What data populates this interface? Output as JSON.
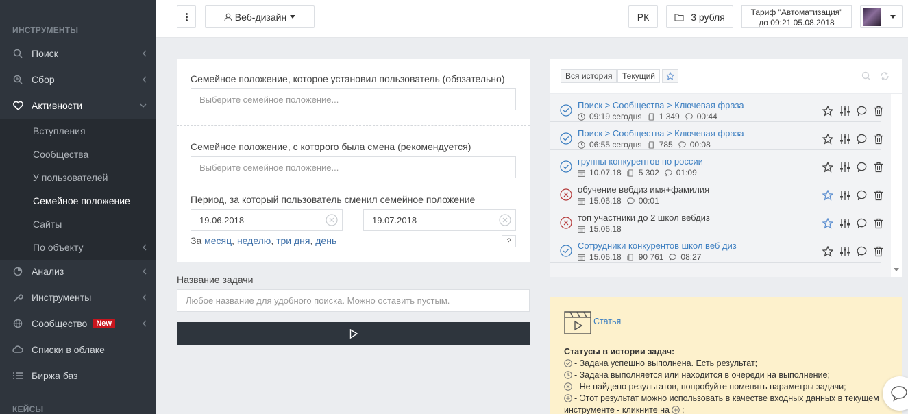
{
  "sidebar": {
    "section_tools": "ИНСТРУМЕНТЫ",
    "section_cases": "КЕЙСЫ",
    "items": [
      {
        "label": "Поиск",
        "icon": "search-icon"
      },
      {
        "label": "Сбор",
        "icon": "zoom-icon"
      },
      {
        "label": "Активности",
        "icon": "heart-icon"
      },
      {
        "label": "Анализ",
        "icon": "pie-icon"
      },
      {
        "label": "Инструменты",
        "icon": "wrench-icon"
      },
      {
        "label": "Сообщество",
        "icon": "globe-icon",
        "badge": "New"
      },
      {
        "label": "Списки в облаке",
        "icon": "cloud-icon"
      },
      {
        "label": "Биржа баз",
        "icon": "list-icon"
      }
    ],
    "sub_items": [
      "Вступления",
      "Сообщества",
      "У пользователей",
      "Семейное положение",
      "Сайты",
      "По объекту"
    ]
  },
  "topbar": {
    "project": "Веб-дизайн",
    "currency": "РК",
    "balance": "3 рубля",
    "tariff_line1": "Тариф \"Автоматизация\"",
    "tariff_line2": "до 09:21 05.08.2018"
  },
  "form": {
    "label_status": "Семейное положение, которое установил пользователь (обязательно)",
    "placeholder_status": "Выберите семейное положение...",
    "label_prev_status": "Семейное положение, с которого была смена (рекомендуется)",
    "placeholder_prev_status": "Выберите семейное положение...",
    "label_period": "Период, за который пользователь сменил семейное положение",
    "date_from": "19.06.2018",
    "date_to": "19.07.2018",
    "period_prefix": "За",
    "period_links": [
      "месяц",
      "неделю",
      "три дня",
      "день"
    ],
    "help": "?",
    "label_task_name": "Название задачи",
    "placeholder_task_name": "Любое название для удобного поиска. Можно оставить пустым."
  },
  "history": {
    "tab_all": "Вся история",
    "tab_current": "Текущий",
    "rows": [
      {
        "status": "success",
        "title": "Поиск > Сообщества > Ключевая фраза",
        "link": true,
        "time": "09:19 сегодня",
        "count": "1 349",
        "duration": "00:44"
      },
      {
        "status": "success",
        "title": "Поиск > Сообщества > Ключевая фраза",
        "link": true,
        "time": "06:55 сегодня",
        "count": "785",
        "duration": "00:08"
      },
      {
        "status": "success",
        "title": "группы конкурентов по россии",
        "link": true,
        "time": "10.07.18",
        "count": "5 302",
        "duration": "01:09"
      },
      {
        "status": "error",
        "title": "обучение вебдиз имя+фамилия",
        "link": false,
        "time": "15.06.18",
        "count": "",
        "duration": "00:01"
      },
      {
        "status": "error",
        "title": "топ участники до 2 школ вебдиз",
        "link": false,
        "time": "15.06.18",
        "count": "",
        "duration": ""
      },
      {
        "status": "success",
        "title": "Сотрудники конкурентов школ веб диз",
        "link": true,
        "time": "15.06.18",
        "count": "90 761",
        "duration": "08:27"
      }
    ]
  },
  "info": {
    "article": "Статья",
    "heading": "Статусы в истории задач:",
    "lines": [
      "- Задача успешно выполнена. Есть результат;",
      "- Задача выполняется или находится в очереди на выполнение;",
      "- Не найдено результатов, попробуйте поменять параметры задачи;",
      "- Этот результат можно использовать в качестве входных данных в текущем",
      "инструменте - кликните на",
      ";"
    ]
  },
  "colors": {
    "sidebar_bg": "#2f353d",
    "link": "#3d7fc1",
    "success": "#3d7fc1",
    "error": "#b53a3a",
    "info_bg": "#fdf1cc",
    "badge": "#c9151e"
  }
}
